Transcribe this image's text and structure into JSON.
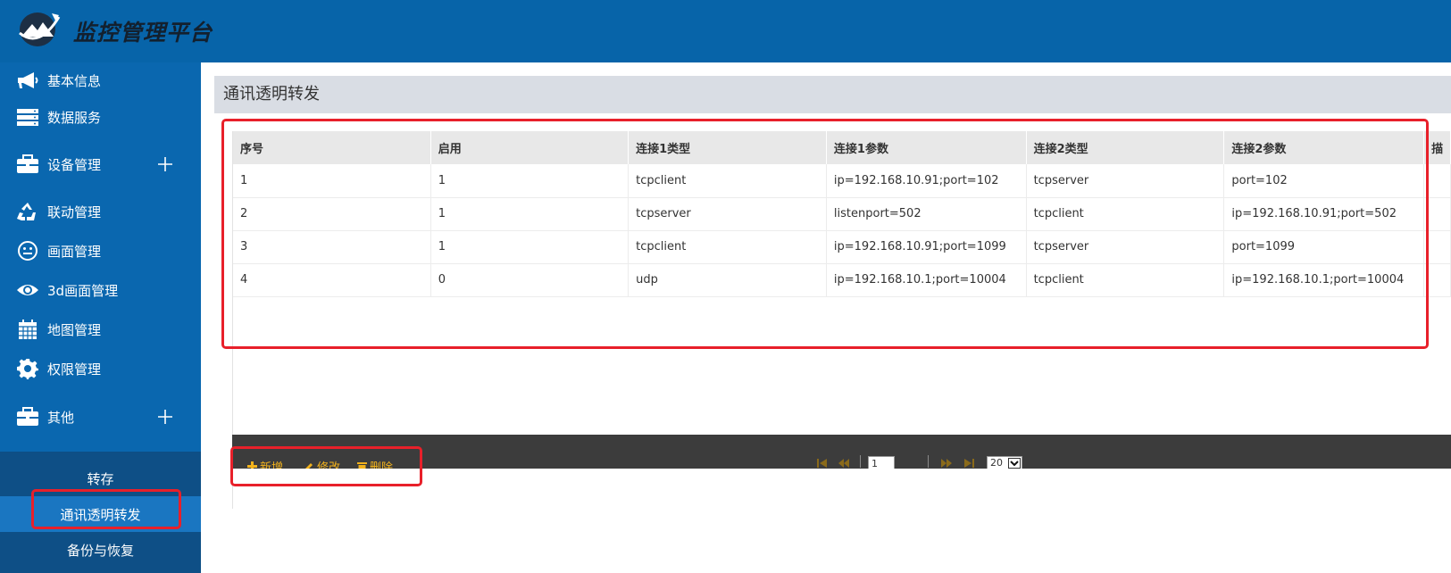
{
  "app": {
    "title": "监控管理平台"
  },
  "sidebar": {
    "items": [
      {
        "label": "基本信息",
        "icon": "megaphone-icon"
      },
      {
        "label": "数据服务",
        "icon": "server-icon"
      },
      {
        "label": "设备管理",
        "icon": "briefcase-icon",
        "expandable": true
      },
      {
        "label": "联动管理",
        "icon": "recycle-icon"
      },
      {
        "label": "画面管理",
        "icon": "smiley-icon"
      },
      {
        "label": "3d画面管理",
        "icon": "eye-icon"
      },
      {
        "label": "地图管理",
        "icon": "calendar-icon"
      },
      {
        "label": "权限管理",
        "icon": "gear-icon"
      },
      {
        "label": "其他",
        "icon": "briefcase-icon",
        "expandable": true
      }
    ],
    "submenu": [
      {
        "label": "转存"
      },
      {
        "label": "通讯透明转发",
        "active": true
      },
      {
        "label": "备份与恢复"
      }
    ]
  },
  "panel": {
    "title": "通讯透明转发"
  },
  "grid": {
    "columns": [
      "序号",
      "启用",
      "连接1类型",
      "连接1参数",
      "连接2类型",
      "连接2参数",
      "描"
    ],
    "rows": [
      [
        "1",
        "1",
        "tcpclient",
        "ip=192.168.10.91;port=102",
        "tcpserver",
        "port=102"
      ],
      [
        "2",
        "1",
        "tcpserver",
        "listenport=502",
        "tcpclient",
        "ip=192.168.10.91;port=502"
      ],
      [
        "3",
        "1",
        "tcpclient",
        "ip=192.168.10.91;port=1099",
        "tcpserver",
        "port=1099"
      ],
      [
        "4",
        "0",
        "udp",
        "ip=192.168.10.1;port=10004",
        "tcpclient",
        "ip=192.168.10.1;port=10004"
      ]
    ]
  },
  "toolbar": {
    "add_label": "新增",
    "edit_label": "修改",
    "delete_label": "删除"
  },
  "pager": {
    "page": "1",
    "page_size": "20"
  },
  "colors": {
    "header": "#0764a9",
    "sidebar": "#0a67af",
    "submenu": "#0e4f86",
    "active": "#1a76c1",
    "toolbar": "#3c3c3c",
    "accent": "#f2b21c",
    "highlight": "#e8202a"
  }
}
